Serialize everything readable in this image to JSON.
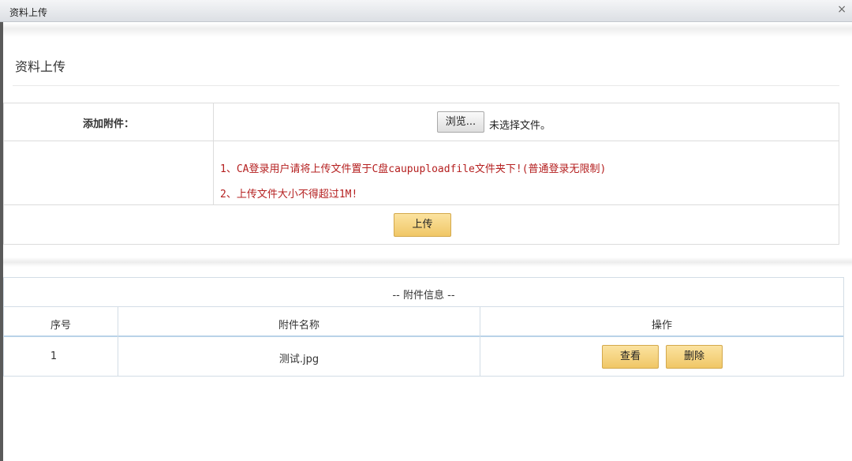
{
  "window": {
    "title": "资料上传",
    "close_glyph": "×"
  },
  "page": {
    "title": "资料上传"
  },
  "form": {
    "attach_label": "添加附件：",
    "browse_label": "浏览...",
    "no_file_text": "未选择文件。",
    "notes": [
      "1、CA登录用户请将上传文件置于C盘caupuploadfile文件夹下!(普通登录无限制)",
      "2、上传文件大小不得超过1M!"
    ],
    "upload_label": "上传"
  },
  "attachments": {
    "caption": "-- 附件信息 --",
    "columns": [
      "序号",
      "附件名称",
      "操作"
    ],
    "rows": [
      {
        "index": "1",
        "name": "测试.jpg",
        "view_label": "查看",
        "delete_label": "删除"
      }
    ]
  },
  "colors": {
    "note_text": "#b52020",
    "button_fill": "#f0c766",
    "table_border": "#d3dde6"
  }
}
